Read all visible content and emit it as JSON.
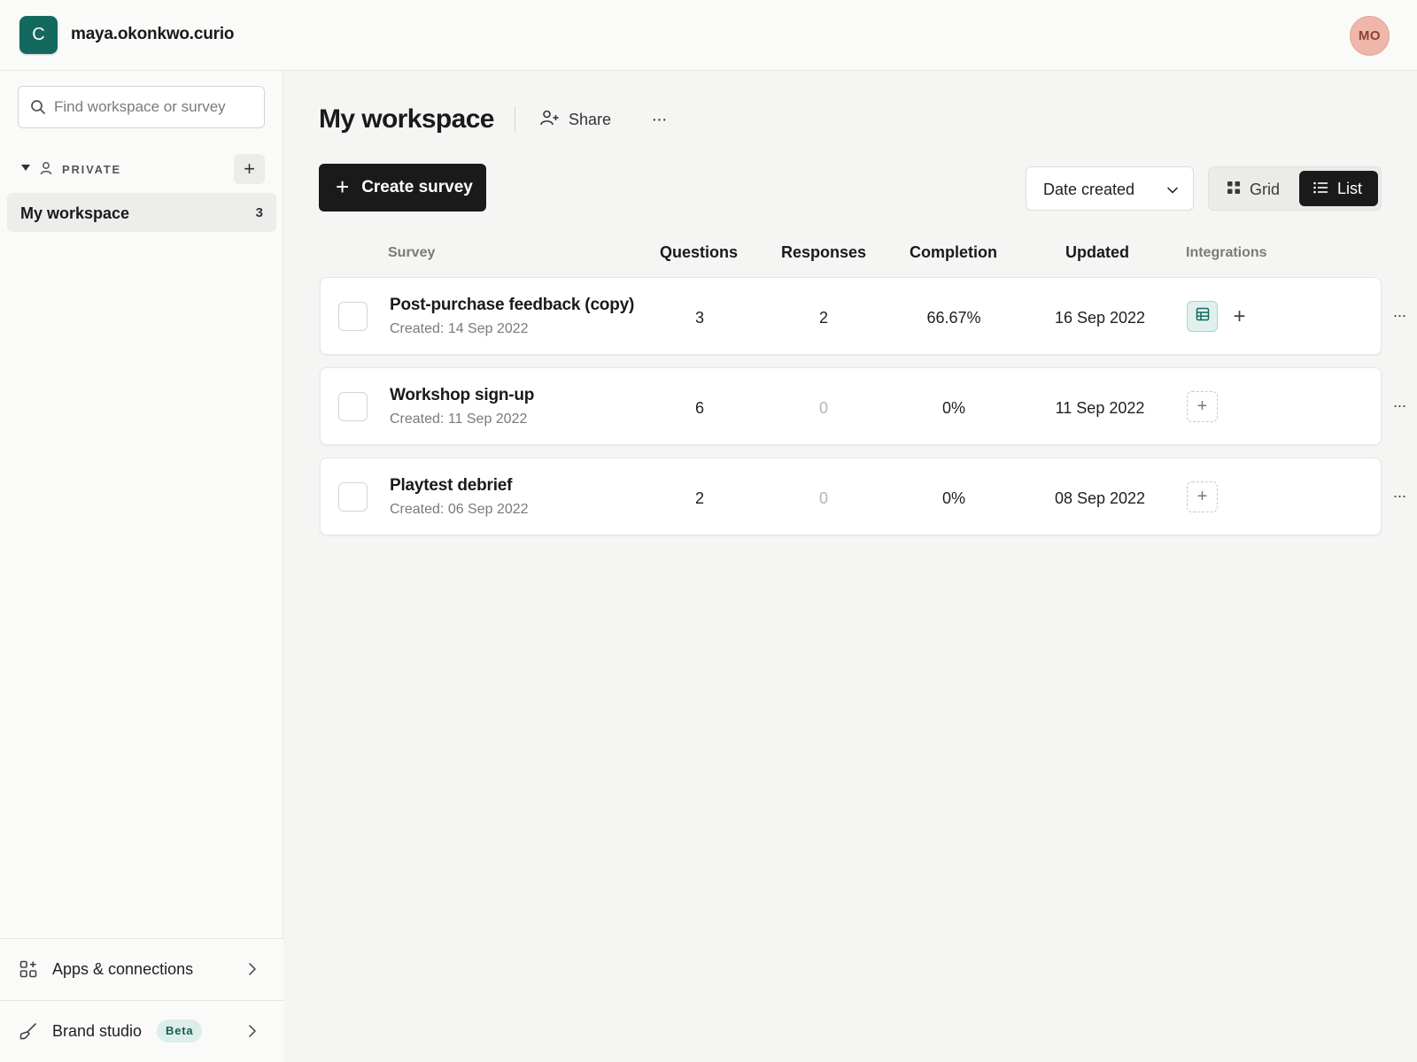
{
  "account": {
    "logo_letter": "C",
    "name": "maya.okonkwo.curio",
    "avatar_initials": "MO"
  },
  "sidebar": {
    "search_placeholder": "Find workspace or survey",
    "section_label": "PRIVATE",
    "add_label": "+",
    "workspace": {
      "name": "My workspace",
      "count": "3"
    },
    "apps_label": "Apps & connections",
    "brand_label": "Brand studio",
    "brand_badge": "Beta"
  },
  "header": {
    "title": "My workspace",
    "share_label": "Share",
    "more_label": "···"
  },
  "toolbar": {
    "create_label": "Create survey",
    "sort_value": "Date created",
    "grid_label": "Grid",
    "list_label": "List",
    "active_view": "List"
  },
  "table": {
    "columns": {
      "survey": "Survey",
      "questions": "Questions",
      "responses": "Responses",
      "completion": "Completion",
      "updated": "Updated",
      "integrations": "Integrations"
    },
    "rows": [
      {
        "title": "Post-purchase feedback (copy)",
        "created": "Created: 14 Sep 2022",
        "questions": "3",
        "responses": "2",
        "completion": "66.67%",
        "updated": "16 Sep 2022",
        "integration": "sheet-icon"
      },
      {
        "title": "Workshop sign-up",
        "created": "Created: 11 Sep 2022",
        "questions": "6",
        "responses": "0",
        "completion": "0%",
        "updated": "11 Sep 2022",
        "integration": "none"
      },
      {
        "title": "Playtest debrief",
        "created": "Created: 06 Sep 2022",
        "questions": "2",
        "responses": "0",
        "completion": "0%",
        "updated": "08 Sep 2022",
        "integration": "none"
      }
    ]
  },
  "colors": {
    "brand": "#13695e",
    "primary_button": "#1a1a1a",
    "avatar_bg": "#eeb7aa",
    "integration_bg": "#e1f0ec"
  }
}
